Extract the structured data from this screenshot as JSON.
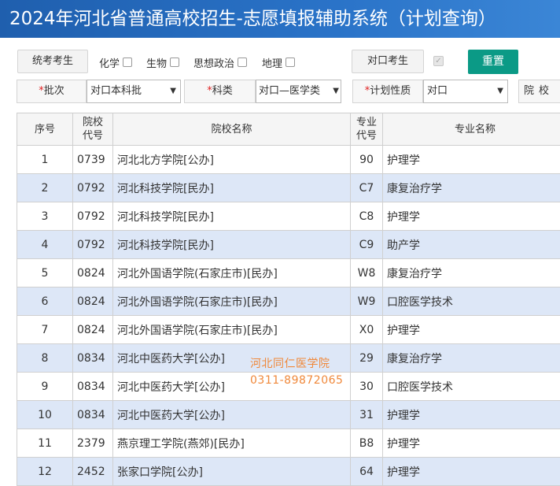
{
  "title": "2024年河北省普通高校招生-志愿填报辅助系统（计划查询）",
  "filters": {
    "exam_type_unified": "统考考生",
    "subjects": [
      {
        "label": "化学",
        "checked": false
      },
      {
        "label": "生物",
        "checked": false
      },
      {
        "label": "思想政治",
        "checked": false
      },
      {
        "label": "地理",
        "checked": false
      }
    ],
    "exam_type_vocational": "对口考生",
    "vocational_checked": true,
    "reset_label": "重置",
    "batch_label": "批次",
    "batch_value": "对口本科批",
    "category_label": "科类",
    "category_value": "对口—医学类",
    "plan_label": "计划性质",
    "plan_value": "对口",
    "school_label_partial": "院校"
  },
  "required_mark": "*",
  "table": {
    "headers": {
      "index": "序号",
      "school_code": [
        "院校",
        "代号"
      ],
      "school_name": "院校名称",
      "major_code": [
        "专业",
        "代号"
      ],
      "major_name": "专业名称"
    },
    "rows": [
      {
        "no": "1",
        "code": "0739",
        "school": "河北北方学院[公办]",
        "mcode": "90",
        "major": "护理学"
      },
      {
        "no": "2",
        "code": "0792",
        "school": "河北科技学院[民办]",
        "mcode": "C7",
        "major": "康复治疗学"
      },
      {
        "no": "3",
        "code": "0792",
        "school": "河北科技学院[民办]",
        "mcode": "C8",
        "major": "护理学"
      },
      {
        "no": "4",
        "code": "0792",
        "school": "河北科技学院[民办]",
        "mcode": "C9",
        "major": "助产学"
      },
      {
        "no": "5",
        "code": "0824",
        "school": "河北外国语学院(石家庄市)[民办]",
        "mcode": "W8",
        "major": "康复治疗学"
      },
      {
        "no": "6",
        "code": "0824",
        "school": "河北外国语学院(石家庄市)[民办]",
        "mcode": "W9",
        "major": "口腔医学技术"
      },
      {
        "no": "7",
        "code": "0824",
        "school": "河北外国语学院(石家庄市)[民办]",
        "mcode": "X0",
        "major": "护理学"
      },
      {
        "no": "8",
        "code": "0834",
        "school": "河北中医药大学[公办]",
        "mcode": "29",
        "major": "康复治疗学"
      },
      {
        "no": "9",
        "code": "0834",
        "school": "河北中医药大学[公办]",
        "mcode": "30",
        "major": "口腔医学技术"
      },
      {
        "no": "10",
        "code": "0834",
        "school": "河北中医药大学[公办]",
        "mcode": "31",
        "major": "护理学"
      },
      {
        "no": "11",
        "code": "2379",
        "school": "燕京理工学院(燕郊)[民办]",
        "mcode": "B8",
        "major": "护理学"
      },
      {
        "no": "12",
        "code": "2452",
        "school": "张家口学院[公办]",
        "mcode": "64",
        "major": "护理学"
      }
    ]
  },
  "watermark": {
    "line1": "河北同仁医学院",
    "line2": "0311-89872065"
  },
  "colors": {
    "header_blue": "#2a73c8",
    "reset_teal": "#0b9a86",
    "row_alt": "#dde7f7",
    "watermark": "#f0883a",
    "required": "#e02020"
  }
}
